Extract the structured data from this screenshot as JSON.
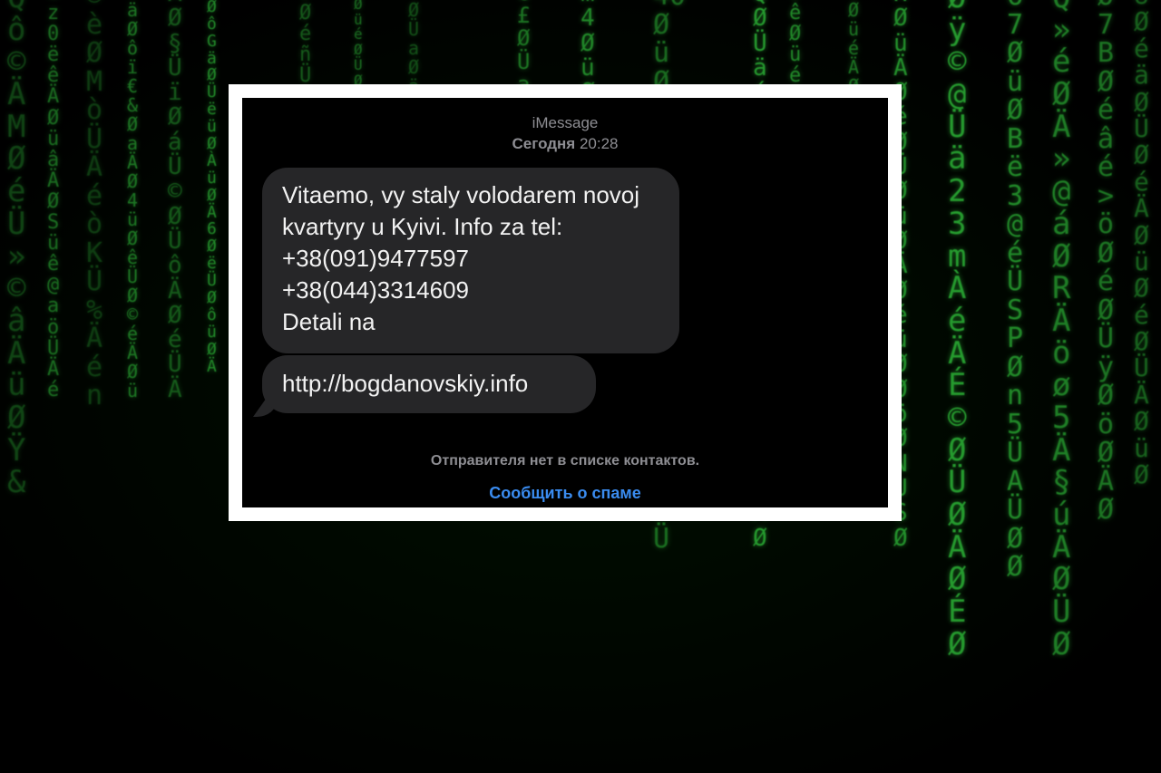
{
  "header": {
    "service": "iMessage",
    "date_label": "Сегодня",
    "time": "20:28"
  },
  "messages": [
    {
      "text": "Vitaemo, vy staly volodarem novoj\nkvartyry u Kyivi. Info za tel:\n+38(091)9477597\n+38(044)3314609\nDetali na"
    },
    {
      "text": "http://bogdanovskiy.info"
    }
  ],
  "footer": {
    "unknown_sender_note": "Отправителя нет в списке контактов.",
    "report_spam_label": "Сообщить о спаме"
  },
  "colors": {
    "bubble": "#262628",
    "link_blue": "#3a8cf0",
    "matrix_green": "#2fbf3a"
  }
}
